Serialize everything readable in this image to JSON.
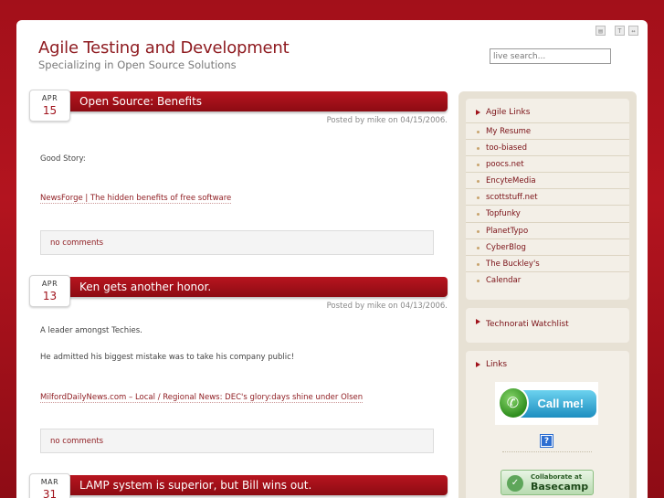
{
  "header": {
    "title": "Agile Testing and Development",
    "tagline": "Specializing in Open Source Solutions",
    "search_placeholder": "live search..."
  },
  "posts": [
    {
      "month": "APR",
      "day": "15",
      "title": "Open Source: Benefits",
      "meta": "Posted by mike on 04/15/2006.",
      "lines": [
        "Good Story:"
      ],
      "link": "NewsForge | The hidden benefits of free software",
      "comments": "no comments"
    },
    {
      "month": "APR",
      "day": "13",
      "title": "Ken gets another honor.",
      "meta": "Posted by mike on 04/13/2006.",
      "lines": [
        "A leader amongst Techies.",
        "He admitted his biggest mistake was to take his company public!"
      ],
      "link": "MilfordDailyNews.com – Local / Regional News: DEC's glory:days shine under Olsen",
      "comments": "no comments"
    },
    {
      "month": "MAR",
      "day": "31",
      "title": "LAMP system is superior, but Bill wins out."
    }
  ],
  "sidebar": {
    "agile_links": {
      "title": "Agile Links",
      "items": [
        "My Resume",
        "too-biased",
        "poocs.net",
        "EncyteMedia",
        "scottstuff.net",
        "Topfunky",
        "PlanetTypo",
        "CyberBlog",
        "The Buckley's",
        "Calendar"
      ]
    },
    "technorati": {
      "title": "Technorati Watchlist"
    },
    "links": {
      "title": "Links",
      "callme_text": "Call me!",
      "help_glyph": "?",
      "basecamp_small": "Collaborate at",
      "basecamp_big": "Basecamp"
    }
  }
}
